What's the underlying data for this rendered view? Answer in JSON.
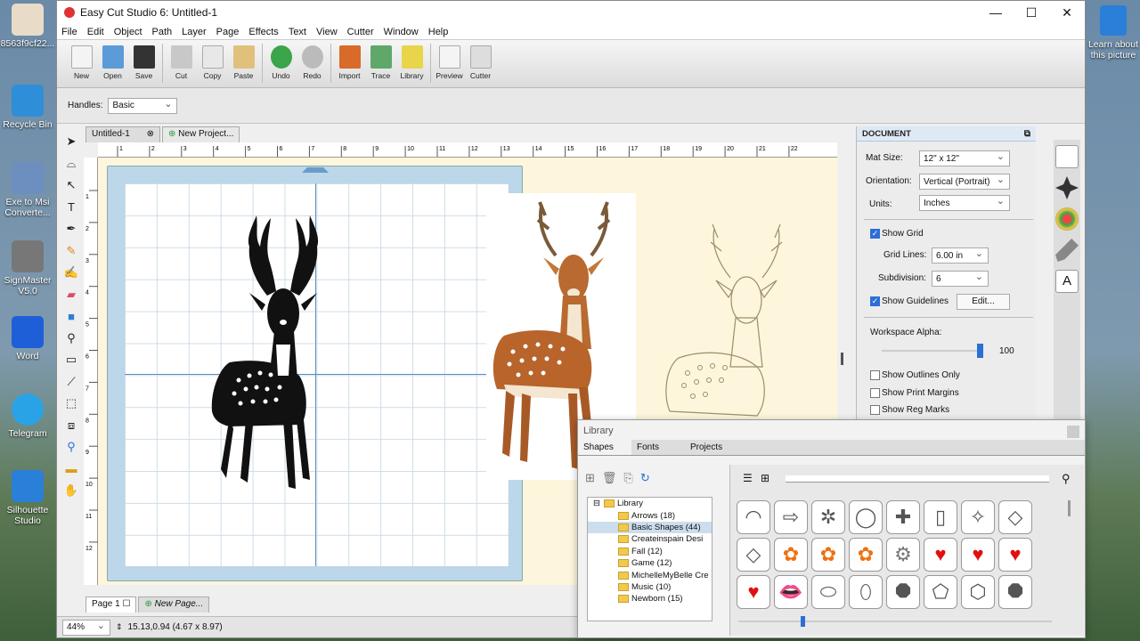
{
  "desktop": [
    {
      "label": "8563f9cf22...",
      "color": "#cfa97a"
    },
    {
      "label": "Recycle Bin",
      "color": "#2f8ed8"
    },
    {
      "label": "Exe to Msi Converte...",
      "color": "#6d8fbf"
    },
    {
      "label": "SignMaster V5.0",
      "color": "#888"
    },
    {
      "label": "Word",
      "color": "#1e5fd8"
    },
    {
      "label": "Telegram",
      "color": "#2aa3e6"
    },
    {
      "label": "Silhouette Studio",
      "color": "#2a7fd8"
    }
  ],
  "desktop_right": "Learn about this picture",
  "window": {
    "title": "Easy Cut Studio 6: Untitled-1",
    "min": "—",
    "max": "☐",
    "close": "✕"
  },
  "menu": [
    "File",
    "Edit",
    "Object",
    "Path",
    "Layer",
    "Page",
    "Effects",
    "Text",
    "View",
    "Cutter",
    "Window",
    "Help"
  ],
  "toolbar": [
    "New",
    "Open",
    "Save",
    "Cut",
    "Copy",
    "Paste",
    "Undo",
    "Redo",
    "Import",
    "Trace",
    "Library",
    "Preview",
    "Cutter"
  ],
  "options": {
    "handles_label": "Handles:",
    "handles_value": "Basic"
  },
  "tabs": {
    "doc": "Untitled-1",
    "new": "New Project..."
  },
  "ruler_h": [
    "1",
    "2",
    "3",
    "4",
    "5",
    "6",
    "7",
    "8",
    "9",
    "10",
    "11",
    "12",
    "13",
    "14",
    "15",
    "16",
    "17",
    "18",
    "19",
    "20",
    "21",
    "22"
  ],
  "ruler_v": [
    "1",
    "2",
    "3",
    "4",
    "5",
    "6",
    "7",
    "8",
    "9",
    "10",
    "11",
    "12"
  ],
  "document": {
    "header": "DOCUMENT",
    "mat_size_label": "Mat Size:",
    "mat_size": "12\" x 12\"",
    "orientation_label": "Orientation:",
    "orientation": "Vertical (Portrait)",
    "units_label": "Units:",
    "units": "Inches",
    "show_grid": "Show Grid",
    "grid_lines_label": "Grid Lines:",
    "grid_lines": "6.00 in",
    "subdivision_label": "Subdivision:",
    "subdivision": "6",
    "show_guidelines": "Show Guidelines",
    "edit": "Edit...",
    "workspace_alpha": "Workspace Alpha:",
    "alpha_value": "100",
    "show_outlines": "Show Outlines Only",
    "show_print": "Show Print Margins",
    "show_reg": "Show Reg Marks"
  },
  "pages": {
    "page1": "Page 1",
    "new_page": "New Page..."
  },
  "status": {
    "zoom": "44%",
    "coords": "15.13,0.94 (4.67 x 8.97)"
  },
  "library": {
    "title": "Library",
    "tabs": [
      "Shapes",
      "Fonts",
      "Projects"
    ],
    "root": "Library",
    "items": [
      "Arrows (18)",
      "Basic Shapes (44)",
      "Createinspain Desi",
      "Fall (12)",
      "Game (12)",
      "MichelleMyBelle Cre",
      "Music (10)",
      "Newborn (15)"
    ],
    "shapes": [
      "◠",
      "⇨",
      "✲",
      "◯",
      "✚",
      "▯",
      "✧",
      "◇",
      "◇",
      "✿",
      "✿",
      "✿",
      "⚙",
      "♥",
      "♥",
      "♥",
      "♥",
      "👄",
      "⬭",
      "⬯",
      "⯃",
      "⬠",
      "⬡",
      "⯃"
    ]
  },
  "colors": {
    "accent": "#2b6fd6",
    "heart": "#e01010",
    "flower": "#f07010"
  }
}
